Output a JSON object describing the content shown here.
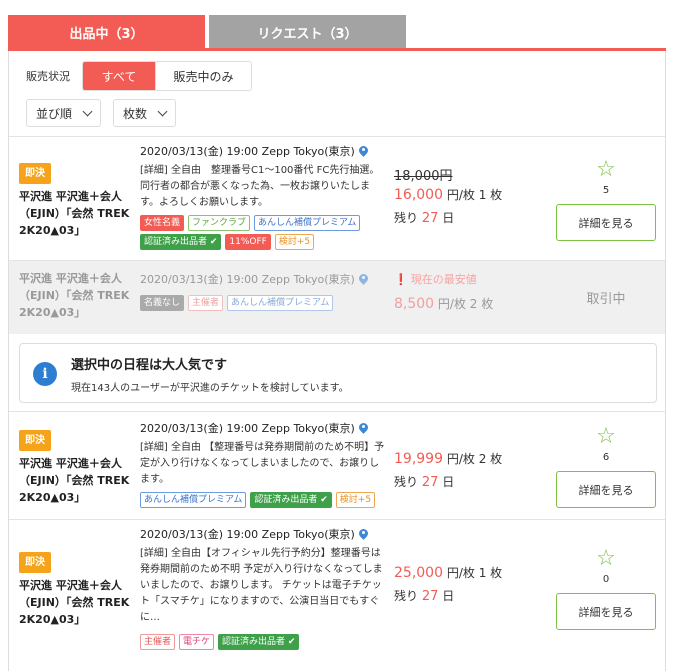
{
  "tabs": [
    {
      "label": "出品中（3）"
    },
    {
      "label": "リクエスト（3）"
    }
  ],
  "filter": {
    "label": "販売状況",
    "options": [
      "すべて",
      "販売中のみ"
    ]
  },
  "sort": {
    "order_label": "並び順",
    "count_label": "枚数"
  },
  "colors": {
    "accent": "#f25c54",
    "green": "#7cc142",
    "orange": "#f5a31a"
  },
  "listings": [
    {
      "badge": "即決",
      "title": "平沢進 平沢進＋会人（EJIN）「会然 TREK 2K20▲03」",
      "date": "2020/03/13(金) 19:00 Zepp Tokyo(東京)",
      "desc": "[詳細] 全自由　整理番号C1〜100番代 FC先行抽選。同行者の都合が悪くなった為、一枚お譲りいたします。よろしくお願いします。",
      "tags": [
        "女性名義",
        "ファンクラブ",
        "あんしん補償プレミアム",
        "認証済み出品者 ✔",
        "11%OFF",
        "検討+5"
      ],
      "old_price": "18,000円",
      "price": "16,000",
      "unit": "円/枚",
      "qty": "1 枚",
      "remain_prefix": "残り",
      "remain_days": "27",
      "remain_suffix": "日",
      "favorites": "5",
      "detail": "詳細を見る"
    },
    {
      "title": "平沢進 平沢進＋会人（EJIN）「会然 TREK 2K20▲03」",
      "date": "2020/03/13(金) 19:00 Zepp Tokyo(東京)",
      "tags": [
        "名義なし",
        "主催者",
        "あんしん補償プレミアム"
      ],
      "note": "現在の最安値",
      "price": "8,500",
      "unit": "円/枚",
      "qty": "2 枚",
      "status": "取引中"
    },
    {
      "badge": "即決",
      "title": "平沢進 平沢進＋会人（EJIN）「会然 TREK 2K20▲03」",
      "date": "2020/03/13(金) 19:00 Zepp Tokyo(東京)",
      "desc": "[詳細] 全自由 【整理番号は発券期間前のため不明】予定が入り行けなくなってしまいましたので、お譲りします。",
      "tags": [
        "あんしん補償プレミアム",
        "認証済み出品者 ✔",
        "検討+5"
      ],
      "price": "19,999",
      "unit": "円/枚",
      "qty": "2 枚",
      "remain_prefix": "残り",
      "remain_days": "27",
      "remain_suffix": "日",
      "favorites": "6",
      "detail": "詳細を見る"
    },
    {
      "badge": "即決",
      "title": "平沢進 平沢進＋会人（EJIN）「会然 TREK 2K20▲03」",
      "date": "2020/03/13(金) 19:00 Zepp Tokyo(東京)",
      "desc": "[詳細] 全自由【オフィシャル先行予約分】整理番号は発券期間前のため不明 予定が入り行けなくなってしまいましたので、お譲りします。 チケットは電子チケット「スマチケ」になりますので、公演日当日でもすぐに…",
      "tags": [
        "主催者",
        "電チケ",
        "認証済み出品者 ✔"
      ],
      "price": "25,000",
      "unit": "円/枚",
      "qty": "1 枚",
      "remain_prefix": "残り",
      "remain_days": "27",
      "remain_suffix": "日",
      "favorites": "0",
      "detail": "詳細を見る"
    }
  ],
  "info": {
    "icon": "i",
    "title": "選択中の日程は大人気です",
    "text": "現在143人のユーザーが平沢進のチケットを検討しています。"
  }
}
